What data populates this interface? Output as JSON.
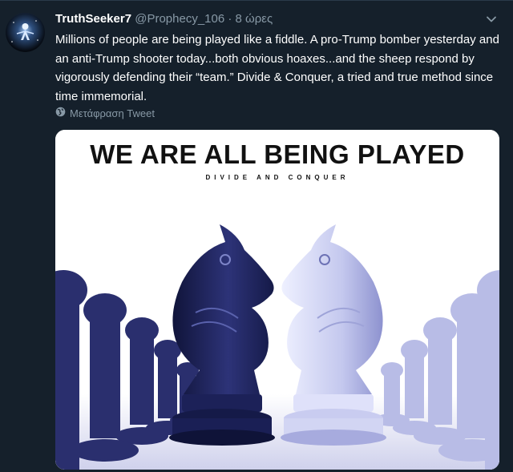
{
  "tweet": {
    "display_name": "TruthSeeker7",
    "handle": "@Prophecy_106",
    "separator": "·",
    "time": "8 ώρες",
    "text": "Millions of people are being played like a fiddle. A pro-Trump bomber yesterday and an anti-Trump shooter today...both obvious hoaxes...and the sheep respond by vigorously defending their “team.” Divide & Conquer, a tried and true method since time immemorial.",
    "translate_label": "Μετάφραση Tweet"
  },
  "image": {
    "title": "WE ARE ALL BEING PLAYED",
    "subtitle": "DIVIDE AND CONQUER"
  },
  "colors": {
    "background": "#15202b",
    "muted_text": "#8899a6",
    "dark_knight": "#1f2460",
    "light_knight": "#c9ccf0"
  }
}
